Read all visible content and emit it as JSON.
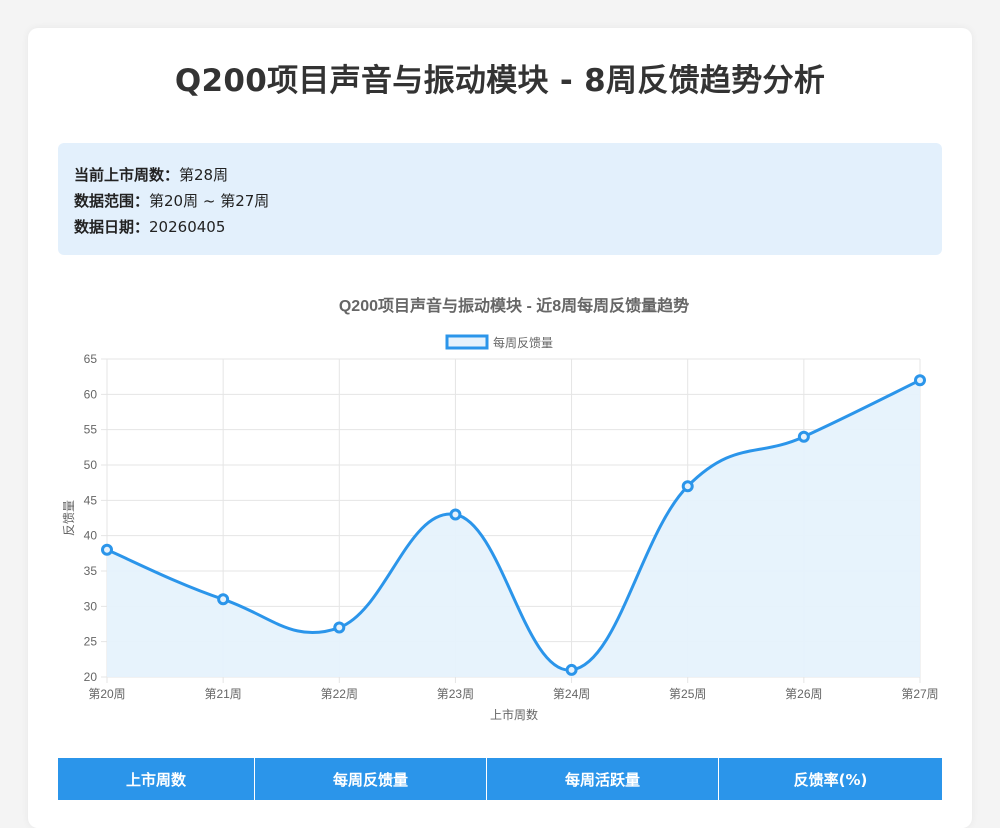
{
  "page": {
    "title": "Q200项目声音与振动模块 - 8周反馈趋势分析"
  },
  "info": {
    "current_week_label": "当前上市周数：",
    "current_week_value": "第28周",
    "range_label": "数据范围：",
    "range_value": "第20周 ~ 第27周",
    "date_label": "数据日期：",
    "date_value": "20260405"
  },
  "colors": {
    "line": "#2b95ea",
    "fill": "#e6f2fc",
    "header": "#2b95ea",
    "info_bg": "#e3f0fc"
  },
  "chart_data": {
    "type": "line",
    "title": "Q200项目声音与振动模块 - 近8周每周反馈量趋势",
    "xlabel": "上市周数",
    "ylabel": "反馈量",
    "categories": [
      "第20周",
      "第21周",
      "第22周",
      "第23周",
      "第24周",
      "第25周",
      "第26周",
      "第27周"
    ],
    "series": [
      {
        "name": "每周反馈量",
        "values": [
          38,
          31,
          27,
          43,
          21,
          47,
          54,
          62
        ]
      }
    ],
    "ylim": [
      20,
      65
    ],
    "yticks": [
      20,
      25,
      30,
      35,
      40,
      45,
      50,
      55,
      60,
      65
    ],
    "grid": true,
    "legend": "top-center",
    "smooth": true,
    "filled": true
  },
  "table": {
    "headers": [
      "上市周数",
      "每周反馈量",
      "每周活跃量",
      "反馈率(%)"
    ]
  }
}
